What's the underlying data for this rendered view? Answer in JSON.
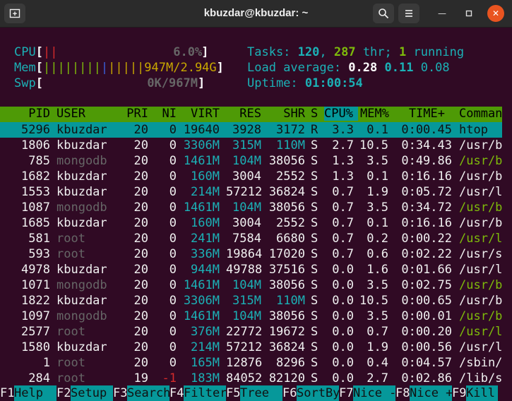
{
  "window": {
    "title": "kbuzdar@kbuzdar: ~"
  },
  "meters": {
    "cpu_label": "CPU",
    "cpu_value": "6.0%",
    "mem_label": "Mem",
    "mem_value": "947M/2.94G",
    "swp_label": "Swp",
    "swp_value": "0K/967M"
  },
  "summary": {
    "tasks_label": "Tasks: ",
    "tasks": "120",
    "thr": "287",
    "thr_label": " thr; ",
    "running": "1",
    "running_label": " running",
    "load_label": "Load average: ",
    "load1": "0.28",
    "load5": "0.11",
    "load15": "0.08",
    "uptime_label": "Uptime: ",
    "uptime": "01:00:54"
  },
  "columns": [
    "PID",
    "USER",
    "PRI",
    "NI",
    "VIRT",
    "RES",
    "SHR",
    "S",
    "CPU%",
    "MEM%",
    "TIME+",
    "Comman"
  ],
  "processes": [
    {
      "pid": "5296",
      "user": "kbuzdar",
      "pri": "20",
      "ni": "0",
      "virt": "19640",
      "res": "3928",
      "shr": "3172",
      "s": "R",
      "cpu": "3.3",
      "mem": "0.1",
      "time": "0:00.45",
      "cmd": "htop"
    },
    {
      "pid": "1806",
      "user": "kbuzdar",
      "pri": "20",
      "ni": "0",
      "virt": "3306M",
      "res": "315M",
      "shr": "110M",
      "s": "S",
      "cpu": "2.7",
      "mem": "10.5",
      "time": "0:34.43",
      "cmd": "/usr/b"
    },
    {
      "pid": "785",
      "user": "mongodb",
      "pri": "20",
      "ni": "0",
      "virt": "1461M",
      "res": "104M",
      "shr": "38056",
      "s": "S",
      "cpu": "1.3",
      "mem": "3.5",
      "time": "0:49.86",
      "cmd": "/usr/b"
    },
    {
      "pid": "1682",
      "user": "kbuzdar",
      "pri": "20",
      "ni": "0",
      "virt": "160M",
      "res": "3004",
      "shr": "2552",
      "s": "S",
      "cpu": "1.3",
      "mem": "0.1",
      "time": "0:16.16",
      "cmd": "/usr/b"
    },
    {
      "pid": "1553",
      "user": "kbuzdar",
      "pri": "20",
      "ni": "0",
      "virt": "214M",
      "res": "57212",
      "shr": "36824",
      "s": "S",
      "cpu": "0.7",
      "mem": "1.9",
      "time": "0:05.72",
      "cmd": "/usr/l"
    },
    {
      "pid": "1087",
      "user": "mongodb",
      "pri": "20",
      "ni": "0",
      "virt": "1461M",
      "res": "104M",
      "shr": "38056",
      "s": "S",
      "cpu": "0.7",
      "mem": "3.5",
      "time": "0:34.72",
      "cmd": "/usr/b"
    },
    {
      "pid": "1685",
      "user": "kbuzdar",
      "pri": "20",
      "ni": "0",
      "virt": "160M",
      "res": "3004",
      "shr": "2552",
      "s": "S",
      "cpu": "0.7",
      "mem": "0.1",
      "time": "0:16.16",
      "cmd": "/usr/b"
    },
    {
      "pid": "581",
      "user": "root",
      "pri": "20",
      "ni": "0",
      "virt": "241M",
      "res": "7584",
      "shr": "6680",
      "s": "S",
      "cpu": "0.7",
      "mem": "0.2",
      "time": "0:00.22",
      "cmd": "/usr/l"
    },
    {
      "pid": "593",
      "user": "root",
      "pri": "20",
      "ni": "0",
      "virt": "336M",
      "res": "19864",
      "shr": "17020",
      "s": "S",
      "cpu": "0.7",
      "mem": "0.6",
      "time": "0:02.22",
      "cmd": "/usr/s"
    },
    {
      "pid": "4978",
      "user": "kbuzdar",
      "pri": "20",
      "ni": "0",
      "virt": "944M",
      "res": "49788",
      "shr": "37516",
      "s": "S",
      "cpu": "0.0",
      "mem": "1.6",
      "time": "0:01.66",
      "cmd": "/usr/l"
    },
    {
      "pid": "1071",
      "user": "mongodb",
      "pri": "20",
      "ni": "0",
      "virt": "1461M",
      "res": "104M",
      "shr": "38056",
      "s": "S",
      "cpu": "0.0",
      "mem": "3.5",
      "time": "0:02.75",
      "cmd": "/usr/b"
    },
    {
      "pid": "1822",
      "user": "kbuzdar",
      "pri": "20",
      "ni": "0",
      "virt": "3306M",
      "res": "315M",
      "shr": "110M",
      "s": "S",
      "cpu": "0.0",
      "mem": "10.5",
      "time": "0:00.65",
      "cmd": "/usr/b"
    },
    {
      "pid": "1097",
      "user": "mongodb",
      "pri": "20",
      "ni": "0",
      "virt": "1461M",
      "res": "104M",
      "shr": "38056",
      "s": "S",
      "cpu": "0.0",
      "mem": "3.5",
      "time": "0:00.01",
      "cmd": "/usr/b"
    },
    {
      "pid": "2577",
      "user": "root",
      "pri": "20",
      "ni": "0",
      "virt": "376M",
      "res": "22772",
      "shr": "19672",
      "s": "S",
      "cpu": "0.0",
      "mem": "0.7",
      "time": "0:00.20",
      "cmd": "/usr/l"
    },
    {
      "pid": "1580",
      "user": "kbuzdar",
      "pri": "20",
      "ni": "0",
      "virt": "214M",
      "res": "57212",
      "shr": "36824",
      "s": "S",
      "cpu": "0.0",
      "mem": "1.9",
      "time": "0:00.56",
      "cmd": "/usr/l"
    },
    {
      "pid": "1",
      "user": "root",
      "pri": "20",
      "ni": "0",
      "virt": "165M",
      "res": "12876",
      "shr": "8296",
      "s": "S",
      "cpu": "0.0",
      "mem": "0.4",
      "time": "0:04.57",
      "cmd": "/sbin/"
    },
    {
      "pid": "284",
      "user": "root",
      "pri": "19",
      "ni": "-1",
      "virt": "183M",
      "res": "84052",
      "shr": "82120",
      "s": "S",
      "cpu": "0.0",
      "mem": "2.7",
      "time": "0:02.86",
      "cmd": "/lib/s"
    }
  ],
  "fkeys": [
    {
      "key": "F1",
      "label": "Help  "
    },
    {
      "key": "F2",
      "label": "Setup "
    },
    {
      "key": "F3",
      "label": "Search"
    },
    {
      "key": "F4",
      "label": "Filter"
    },
    {
      "key": "F5",
      "label": "Tree  "
    },
    {
      "key": "F6",
      "label": "SortBy"
    },
    {
      "key": "F7",
      "label": "Nice -"
    },
    {
      "key": "F8",
      "label": "Nice +"
    },
    {
      "key": "F9",
      "label": "Kill  "
    }
  ],
  "colors": {
    "background": "#300a24",
    "header_bar": "#4e9a06",
    "selection": "#06989a",
    "close_button": "#e95420"
  }
}
